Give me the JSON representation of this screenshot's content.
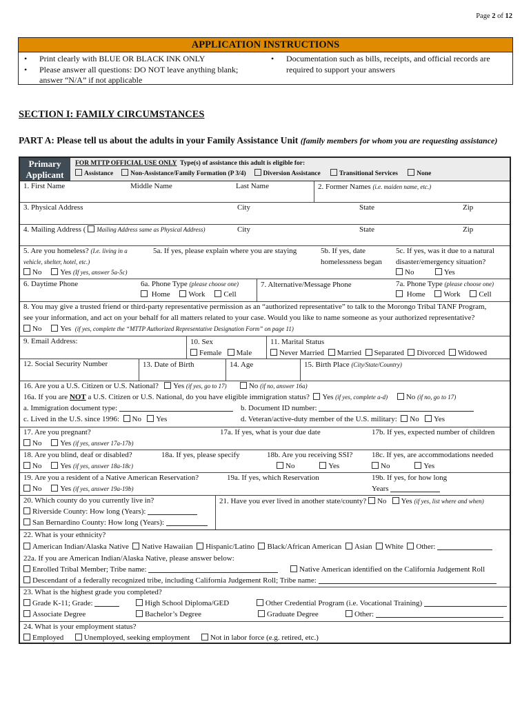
{
  "page": {
    "label": "Page",
    "current": "2",
    "of": "of",
    "total": "12"
  },
  "instructions": {
    "title": "APPLICATION INSTRUCTIONS",
    "left": [
      "Print clearly with BLUE OR BLACK INK ONLY",
      "Please answer all questions: DO NOT leave anything blank; answer “N/A” if not applicable"
    ],
    "right": [
      "Documentation such as bills, receipts, and official records are required to support your answers"
    ]
  },
  "section_title": "SECTION I: FAMILY CIRCUMSTANCES",
  "part_a": {
    "title": "PART A: Please tell us about the adults in your Family Assistance Unit",
    "note": "(family members for whom you are requesting assistance)"
  },
  "header": {
    "primary": "Primary",
    "applicant": "Applicant",
    "official_use": "FOR MTTP OFFICIAL USE ONLY",
    "eligible": "Type(s) of assistance this adult is eligible for:",
    "options": [
      "Assistance",
      "Non-Assistance/Family Formation (P 3/4)",
      "Diversion Assistance",
      "Transitional Services",
      "None"
    ]
  },
  "q1": {
    "first": "1. First Name",
    "middle": "Middle Name",
    "last": "Last Name",
    "former": "2. Former Names",
    "former_note": "(i.e. maiden name, etc.)"
  },
  "q3": {
    "label": "3. Physical Address",
    "city": "City",
    "state": "State",
    "zip": "Zip"
  },
  "q4": {
    "label": "4. Mailing Address (",
    "note": "Mailing Address same as Physical Address)",
    "city": "City",
    "state": "State",
    "zip": "Zip"
  },
  "q5": {
    "label": "5. Are you homeless?",
    "note1": "(I.e. living in a",
    "note2": "vehicle, shelter, hotel, etc.)",
    "no": "No",
    "yes": "Yes",
    "yes_note": "(If yes, answer 5a-5c)",
    "a": "5a. If yes, please explain where you are staying",
    "b1": "5b. If yes, date",
    "b2": "homelessness began",
    "c1": "5c. If yes, was it due to a natural",
    "c2": "disaster/emergency situation?",
    "c_no": "No",
    "c_yes": "Yes"
  },
  "q6": {
    "label": "6. Daytime Phone",
    "type": "6a. Phone Type",
    "type_note": "(please choose one)",
    "opts": [
      "Home",
      "Work",
      "Cell"
    ],
    "alt": "7. Alternative/Message Phone",
    "type7": "7a. Phone Type",
    "type7_note": "(please choose one)",
    "opts7": [
      "Home",
      "Work",
      "Cell"
    ]
  },
  "q8": {
    "line1": "8. You may give a trusted friend or third-party representative permission as an “authorized representative” to talk to the Morongo Tribal TANF Program,",
    "line2": "see your information, and act on your behalf for all matters related to your case. Would you like to name someone as your authorized representative?",
    "no": "No",
    "yes": "Yes",
    "yes_note": "(if yes, complete the “MTTP Authorized Representative Designation Form” on page 11)"
  },
  "q9": {
    "email": "9. Email Address:",
    "sex": "10. Sex",
    "sex_opts": [
      "Female",
      "Male"
    ],
    "marital": "11. Marital Status",
    "marital_opts": [
      "Never Married",
      "Married",
      "Separated",
      "Divorced",
      "Widowed"
    ]
  },
  "q12": {
    "ssn": "12. Social Security Number",
    "dob": "13. Date of Birth",
    "age": "14. Age",
    "birth": "15. Birth Place",
    "birth_note": "(City/State/Country)"
  },
  "q16": {
    "label": "16. Are you a U.S. Citizen or U.S. National?",
    "yes": "Yes",
    "yes_note": "(if yes, go to 17)",
    "no": "No",
    "no_note": "(if no, answer 16a)",
    "a_pre": "16a. If you are",
    "a_not": "NOT",
    "a_post": "a U.S. Citizen or U.S. National, do you have eligible immigration status?",
    "a_yes": "Yes",
    "a_yes_note": "(if yes, complete a-d)",
    "a_no": "No",
    "a_no_note": "(if no, go to 17)",
    "doc_type": "a. Immigration document type:",
    "doc_id": "b. Document ID number:",
    "lived": "c. Lived in the U.S. since 1996:",
    "lived_no": "No",
    "lived_yes": "Yes",
    "veteran": "d. Veteran/active-duty member of the U.S. military:",
    "vet_no": "No",
    "vet_yes": "Yes"
  },
  "q17": {
    "label": "17. Are you pregnant?",
    "no": "No",
    "yes": "Yes",
    "yes_note": "(if yes, answer 17a-17b)",
    "a": "17a. If yes, what is your due date",
    "b": "17b. If yes, expected number of children"
  },
  "q18": {
    "label": "18. Are you blind, deaf or disabled?",
    "no": "No",
    "yes": "Yes",
    "yes_note": "(if yes, answer 18a-18c)",
    "a": "18a. If yes, please specify",
    "b": "18b. Are you receiving SSI?",
    "b_no": "No",
    "b_yes": "Yes",
    "c": "18c. If yes, are accommodations needed",
    "c_no": "No",
    "c_yes": "Yes"
  },
  "q19": {
    "label": "19. Are you a resident of a Native American Reservation?",
    "no": "No",
    "yes": "Yes",
    "yes_note": "(if yes, answer 19a-19b)",
    "a": "19a. If yes, which Reservation",
    "b": "19b. If yes, for how long",
    "years": "Years"
  },
  "q20": {
    "label": "20. Which county do you currently live in?",
    "riverside": "Riverside County: How long (Years):",
    "sanbern": "San Bernardino County: How long (Years):"
  },
  "q21": {
    "label": "21. Have you ever lived in another state/county?",
    "no": "No",
    "yes": "Yes",
    "yes_note": "(if yes, list where and when)"
  },
  "q22": {
    "label": "22. What is your ethnicity?",
    "opts": [
      "American Indian/Alaska Native",
      "Native Hawaiian",
      "Hispanic/Latino",
      "Black/African American",
      "Asian",
      "White",
      "Other:"
    ],
    "a": "22a. If you are American Indian/Alaska Native, please answer below:",
    "enrolled": "Enrolled Tribal Member; Tribe name:",
    "judgement": "Native American identified on the California Judgement Roll",
    "descendant": "Descendant of a federally recognized tribe, including California Judgement Roll; Tribe name:"
  },
  "q23": {
    "label": "23. What is the highest grade you completed?",
    "k11": "Grade K-11; Grade:",
    "hs": "High School Diploma/GED",
    "other_cred": "Other Credential Program (i.e. Vocational Training)",
    "assoc": "Associate Degree",
    "bach": "Bachelor’s Degree",
    "grad": "Graduate Degree",
    "other": "Other:"
  },
  "q24": {
    "label": "24. What is your employment status?",
    "opts": [
      "Employed",
      "Unemployed, seeking employment",
      "Not in labor force (e.g. retired, etc.)"
    ]
  }
}
